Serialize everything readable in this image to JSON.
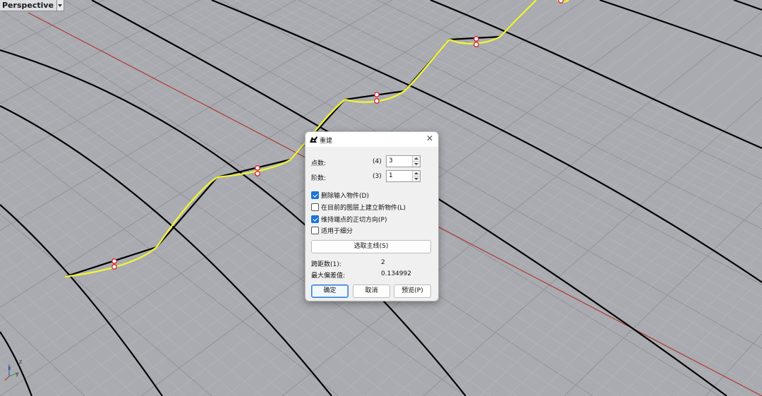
{
  "viewport": {
    "name": "Perspective",
    "axes": {
      "x": "x",
      "y": "y",
      "z": "z"
    }
  },
  "colors": {
    "background": "#a9abb0",
    "grid_minor": "#b6b8bc",
    "grid_major": "#8f9196",
    "x_axis_line": "#b03a33",
    "surface_edge": "#000000",
    "rebuilt_curve": "#f2f23a",
    "control_point": "#d4252c",
    "accent": "#1a73d9"
  },
  "dialog": {
    "title": "重建",
    "point_count": {
      "label": "点数:",
      "original": "(4)",
      "value": "3"
    },
    "degree": {
      "label": "阶数:",
      "original": "(3)",
      "value": "1"
    },
    "options": [
      {
        "label": "删除输入物件(D)",
        "checked": true
      },
      {
        "label": "在目前的图层上建立新物件(L)",
        "checked": false
      },
      {
        "label": "维持端点的正切方向(P)",
        "checked": true
      },
      {
        "label": "适用于细分",
        "checked": false
      }
    ],
    "select_main_curve": "选取主线(S)",
    "span_count": {
      "label": "跨距数(1):",
      "value": "2"
    },
    "max_deviation": {
      "label": "最大偏差值:",
      "value": "0.134992"
    },
    "buttons": {
      "ok": "确定",
      "cancel": "取消",
      "preview": "预览(P)"
    }
  }
}
